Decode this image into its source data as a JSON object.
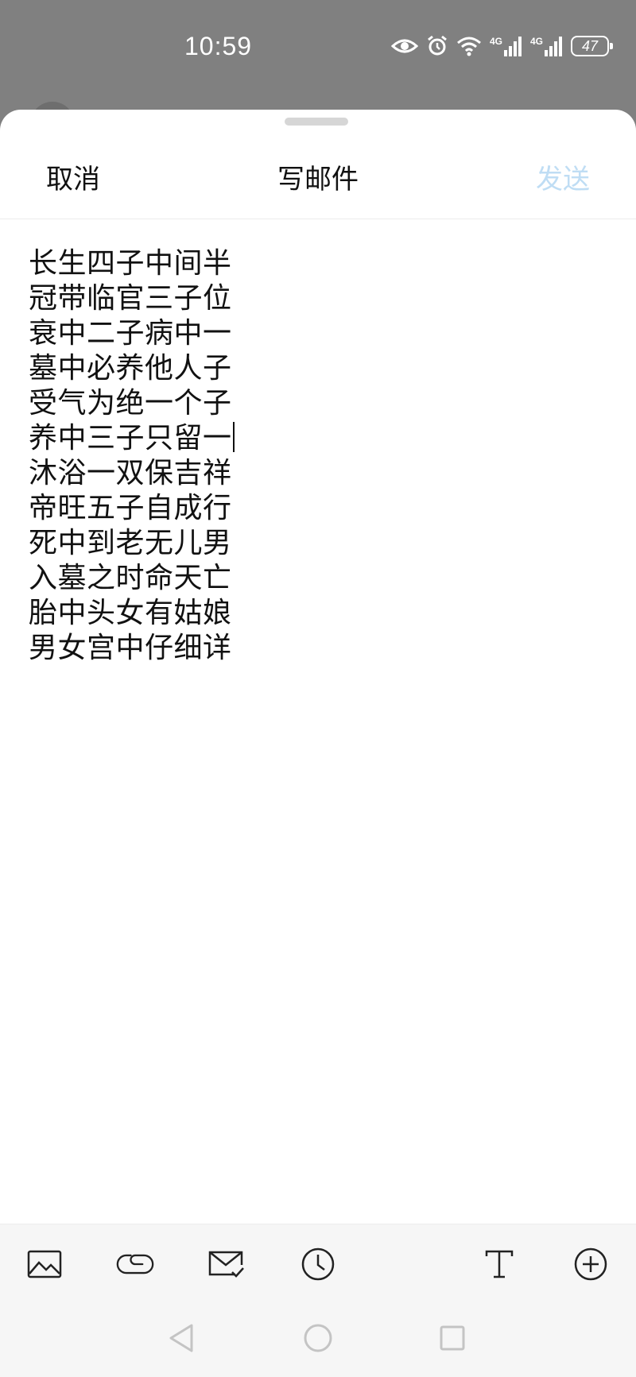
{
  "status_bar": {
    "time": "10:59",
    "network_1": "4G",
    "network_2": "4G",
    "battery": "47",
    "icons": [
      "eye-icon",
      "alarm-icon",
      "wifi-icon",
      "signal-icon",
      "signal-icon",
      "battery-icon"
    ]
  },
  "compose": {
    "cancel_label": "取消",
    "title": "写邮件",
    "send_label": "发送",
    "send_color": "#bfddf4",
    "body_lines": [
      "长生四子中间半",
      "冠带临官三子位",
      "衰中二子病中一",
      "墓中必养他人子",
      "受气为绝一个子",
      "养中三子只留一",
      "沐浴一双保吉祥",
      "帝旺五子自成行",
      "死中到老无儿男",
      "入墓之时命天亡",
      "胎中头女有姑娘",
      "男女宫中仔细详"
    ]
  },
  "toolbar": {
    "icons": [
      "image-icon",
      "attachment-icon",
      "mail-check-icon",
      "clock-icon",
      "text-format-icon",
      "add-circle-icon"
    ]
  },
  "nav_bar": {
    "icons": [
      "back-triangle-icon",
      "home-circle-icon",
      "recents-square-icon"
    ]
  }
}
